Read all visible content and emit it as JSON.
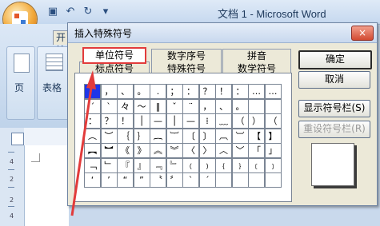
{
  "window": {
    "title": "文档 1 - Microsoft Word"
  },
  "ribbon": {
    "tab_label": "开始",
    "group_items": [
      "页",
      "表格"
    ],
    "group_label": "表格"
  },
  "ruler": {
    "numbers": [
      "4",
      "2",
      "2",
      "4"
    ]
  },
  "dialog": {
    "title": "插入特殊符号",
    "close_label": "×",
    "tabs_row1": [
      "单位符号",
      "数字序号",
      "拼音"
    ],
    "tabs_row2": [
      "标点符号",
      "特殊符号",
      "数学符号"
    ],
    "active_tab": "单位符号",
    "symbols": [
      [
        "",
        "，",
        "、",
        "。",
        ".",
        "；",
        "：",
        "？",
        "！",
        "：",
        "…",
        "…"
      ],
      [
        "ˊ",
        "ˋ",
        "々",
        "～",
        "‖",
        "ˇ",
        "¨",
        "，",
        "、",
        "。",
        "",
        ""
      ],
      [
        "：",
        "？",
        "！",
        "│",
        "—",
        "│",
        "—",
        "⁞",
        "﹏",
        "（",
        "）",
        "（"
      ],
      [
        "︵",
        "︶",
        "｛",
        "｝",
        "︷",
        "︸",
        "〔",
        "〕",
        "︹",
        "︺",
        "【",
        "】"
      ],
      [
        "︻",
        "︼",
        "《",
        "》",
        "︽",
        "︾",
        "〈",
        "〉",
        "︿",
        "﹀",
        "「",
        "」"
      ],
      [
        "﹁",
        "﹂",
        "『",
        "』",
        "﹃",
        "﹄",
        "﹙",
        "﹚",
        "﹛",
        "﹜",
        "﹝",
        "﹞"
      ],
      [
        "‘",
        "’",
        "“",
        "”",
        "〝",
        "〞",
        "ˋ",
        "ˊ",
        "",
        "",
        "",
        ""
      ]
    ],
    "buttons": {
      "ok": "确定",
      "cancel": "取消",
      "show_bar": "显示符号栏(S)",
      "reset_bar": "重设符号栏(R)"
    }
  },
  "colors": {
    "highlight_red": "#e23b3b",
    "selected_cell": "#1e36e8"
  }
}
